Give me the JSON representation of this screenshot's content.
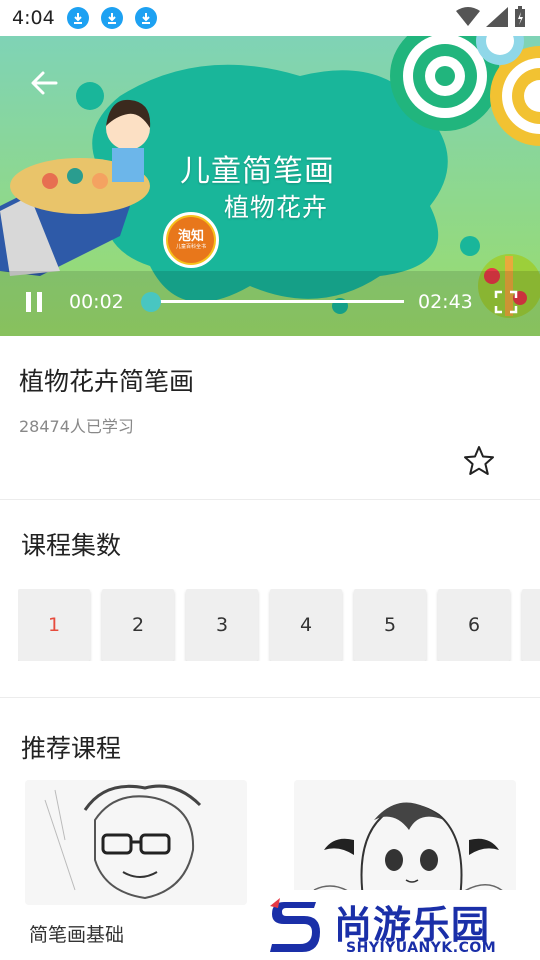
{
  "status_bar": {
    "time": "4:04"
  },
  "player": {
    "cover_title": "儿童简笔画",
    "cover_subtitle": "植物花卉",
    "brand_name": "泡知",
    "brand_sub": "儿童百科全书",
    "current_time": "00:02",
    "total_time": "02:43",
    "progress": 0.012
  },
  "course": {
    "title": "植物花卉简笔画",
    "learners": "28474人已学习"
  },
  "episodes_section": {
    "title": "课程集数",
    "items": [
      "1",
      "2",
      "3",
      "4",
      "5",
      "6"
    ],
    "active_index": 0
  },
  "recommend_section": {
    "title": "推荐课程",
    "cards": [
      {
        "name": "简笔画基础"
      },
      {
        "name": ""
      }
    ]
  },
  "watermark": {
    "name": "尚游乐园",
    "url": "SHYIYUANYK.COM"
  },
  "colors": {
    "accent": "#48c6c1",
    "active_episode": "#e64b3c",
    "watermark": "#1a2fa8"
  }
}
